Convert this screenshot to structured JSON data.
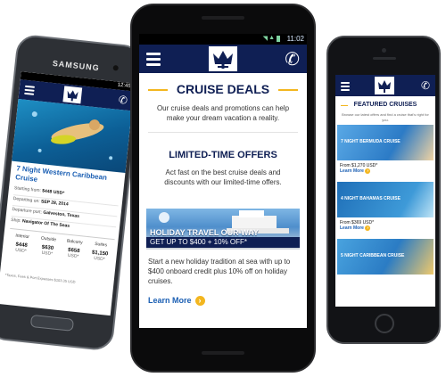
{
  "samsung": {
    "brand": "SAMSUNG",
    "status_time": "12:45",
    "cruise_title": "7 Night Western Caribbean Cruise",
    "rows": [
      {
        "label": "Starting from:",
        "value": "$448 USD*"
      },
      {
        "label": "Departing on:",
        "value": "SEP 28, 2014"
      },
      {
        "label": "Departure port:",
        "value": "Galveston, Texas"
      },
      {
        "label": "Ship:",
        "value": "Navigator Of The Seas"
      }
    ],
    "cabins": [
      {
        "name": "Interior",
        "price": "$448",
        "unit": "USD*"
      },
      {
        "name": "Outside",
        "price": "$630",
        "unit": "USD*"
      },
      {
        "name": "Balcony",
        "price": "$658",
        "unit": "USD*"
      },
      {
        "name": "Suites",
        "price": "$1,150",
        "unit": "USD*"
      }
    ],
    "footnote": "*Taxes, Fees & Port Expenses $103.35 USD"
  },
  "nexus": {
    "status_time": "11:02",
    "heading": "CRUISE DEALS",
    "intro": "Our cruise deals and promotions can help make your dream vacation a reality.",
    "section_heading": "LIMITED-TIME OFFERS",
    "section_text": "Act fast on the best cruise deals and discounts with our limited-time offers.",
    "banner_title": "HOLIDAY TRAVEL OUR WAY",
    "banner_sub": "GET UP TO $400 + 10% OFF*",
    "body_text": "Start a new holiday tradition at sea with up to $400 onboard credit plus 10% off on holiday cruises.",
    "learn_more": "Learn More",
    "arrow": "›"
  },
  "iphone": {
    "heading": "FEATURED CRUISES",
    "intro": "Browse our latest offers and find a cruise that's right for you.",
    "cards": [
      {
        "banner": "7 NIGHT BERMUDA CRUISE",
        "price": "From $1,270 USD*",
        "link": "Learn More",
        "tint": "#3d8fd6"
      },
      {
        "banner": "4 NIGHT BAHAMAS CRUISE",
        "price": "From $369 USD*",
        "link": "Learn More",
        "tint": "#2a7fc4"
      },
      {
        "banner": "5 NIGHT CARIBBEAN CRUISE",
        "price": "",
        "link": "",
        "tint": "#3a96d8"
      }
    ]
  },
  "colors": {
    "navy": "#0f1f54",
    "accent_yellow": "#f3b61f",
    "link_blue": "#1b5fb3"
  }
}
